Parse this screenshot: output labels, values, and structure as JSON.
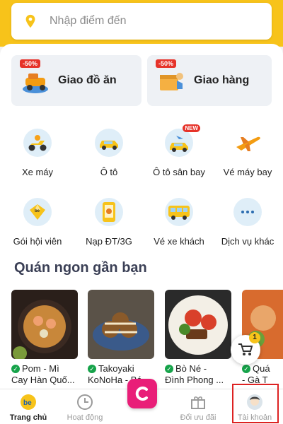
{
  "search": {
    "placeholder": "Nhập điểm đến"
  },
  "main_services": [
    {
      "label": "Giao đồ ăn",
      "badge": "-50%"
    },
    {
      "label": "Giao hàng",
      "badge": "-50%"
    }
  ],
  "services": [
    {
      "label": "Xe máy",
      "icon": "motorbike-icon"
    },
    {
      "label": "Ô tô",
      "icon": "car-icon"
    },
    {
      "label": "Ô tô sân bay",
      "icon": "airport-car-icon",
      "badge": "NEW"
    },
    {
      "label": "Vé máy bay",
      "icon": "airplane-icon"
    },
    {
      "label": "Gói hội viên",
      "icon": "membership-icon"
    },
    {
      "label": "Nạp ĐT/3G",
      "icon": "topup-icon"
    },
    {
      "label": "Vé xe khách",
      "icon": "bus-icon"
    },
    {
      "label": "Dịch vụ khác",
      "icon": "more-icon"
    }
  ],
  "nearby": {
    "title": "Quán ngon gần bạn",
    "restaurants": [
      {
        "line1": "Pom - Mì",
        "line2": "Cay Hàn Quố..."
      },
      {
        "line1": "Takoyaki",
        "line2": "KoNoHa - Bá..."
      },
      {
        "line1": "Bò Né -",
        "line2": "Đình Phong ..."
      },
      {
        "line1": "Quá",
        "line2": "- Gà T"
      }
    ]
  },
  "cart": {
    "count": "1"
  },
  "nav": [
    {
      "label": "Trang chủ",
      "icon": "be-home-icon",
      "active": true
    },
    {
      "label": "Hoạt động",
      "icon": "clock-icon"
    },
    {
      "label": "",
      "icon": "center-c-icon"
    },
    {
      "label": "Đổi ưu đãi",
      "icon": "gift-icon"
    },
    {
      "label": "Tài khoản",
      "icon": "avatar-icon"
    }
  ],
  "colors": {
    "brand": "#f7c31a",
    "accent_pink": "#e91e78",
    "badge_red": "#e6332a"
  }
}
